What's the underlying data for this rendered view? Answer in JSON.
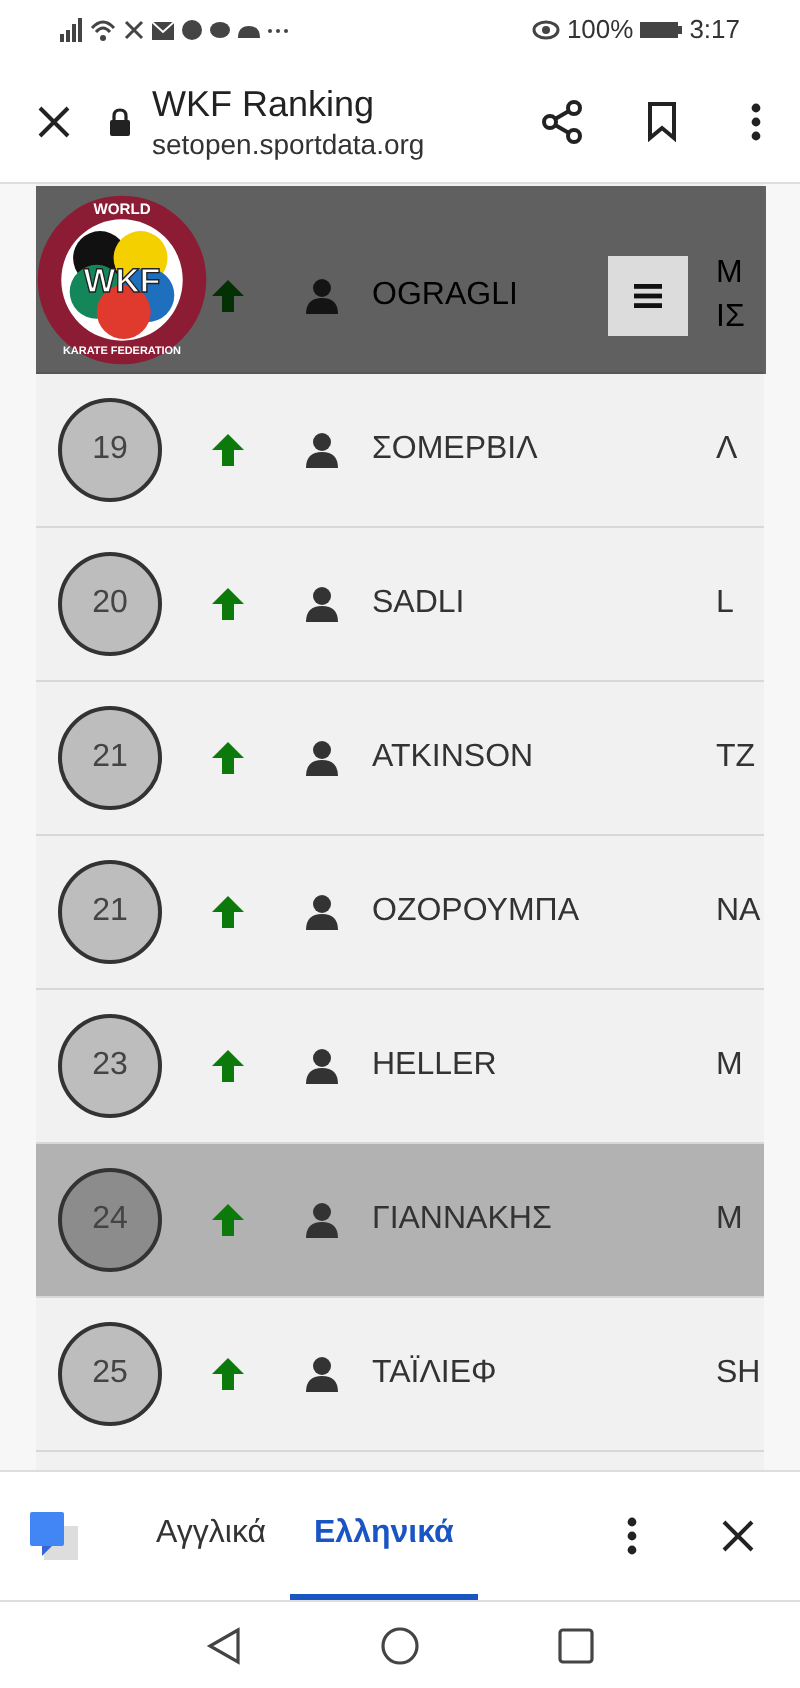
{
  "status_bar": {
    "battery": "100%",
    "time": "3:17"
  },
  "browser_bar": {
    "title": "WKF Ranking",
    "url": "setopen.sportdata.org"
  },
  "logo": {
    "top": "WORLD",
    "center": "WKF",
    "bottom": "KARATE FEDERATION"
  },
  "rows": [
    {
      "rising": true,
      "name": "OGRAGLI",
      "column_4": [
        "Μ",
        "ΙΣ"
      ],
      "selected": false
    },
    {
      "rank": "19",
      "rising": true,
      "name": "ΣΟΜΕΡΒΙΛ",
      "column_4": [
        "Λ"
      ],
      "selected": false
    },
    {
      "rank": "20",
      "rising": true,
      "name": "SADLI",
      "column_4": [
        "L"
      ],
      "selected": false
    },
    {
      "rank": "21",
      "rising": true,
      "name": "ATKINSON",
      "column_4": [
        "ΤΖ"
      ],
      "selected": false
    },
    {
      "rank": "21",
      "rising": true,
      "name": "ΟΖΟΡΟΥΜΠΑ",
      "column_4": [
        "ΝΑ"
      ],
      "selected": false
    },
    {
      "rank": "23",
      "rising": true,
      "name": "HELLER",
      "column_4": [
        "Μ"
      ],
      "selected": false
    },
    {
      "rank": "24",
      "rising": true,
      "name": "ΓΙΑΝΝΑΚΗΣ",
      "column_4": [
        "Μ"
      ],
      "selected": true
    },
    {
      "rank": "25",
      "rising": true,
      "name": "ΤΑΪΛΙΕΦ",
      "column_4": [
        "SH"
      ],
      "selected": false
    }
  ],
  "translate_bar": {
    "languages": [
      {
        "label": "Αγγλικά",
        "selected": false
      },
      {
        "label": "Ελληνικά",
        "selected": true
      }
    ]
  }
}
